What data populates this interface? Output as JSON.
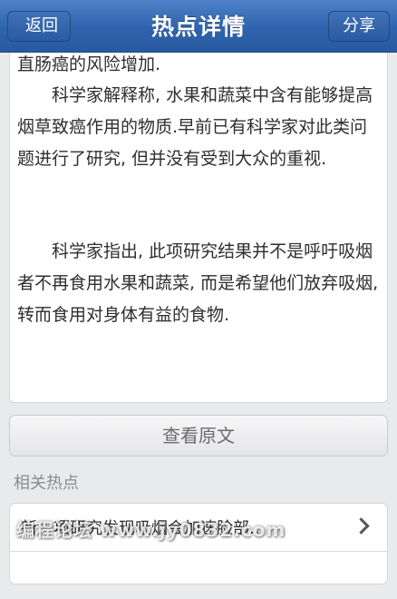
{
  "header": {
    "title": "热点详情",
    "back_label": "返回",
    "share_label": "分享"
  },
  "article": {
    "paragraphs": [
      "直肠癌的风险增加.",
      "科学家解释称, 水果和蔬菜中含有能够提高烟草致癌作用的物质.早前已有科学家对此类问题进行了研究, 但并没有受到大众的重视.",
      "科学家指出, 此项研究结果并不是呼吁吸烟者不再食用水果和蔬菜, 而是希望他们放弃吸烟, 转而食用对身体有益的食物."
    ]
  },
  "view_original_label": "查看原文",
  "related": {
    "section_title": "相关热点",
    "items": [
      "新一项研究发现吸烟会加速脸部...",
      ""
    ]
  },
  "watermark": "编程论坛 www.jy0832.com",
  "colors": {
    "header_blue": "#2f63ad",
    "background": "#e9eaec"
  },
  "icons": {
    "related_item_arrow": "chevron-right-icon"
  }
}
